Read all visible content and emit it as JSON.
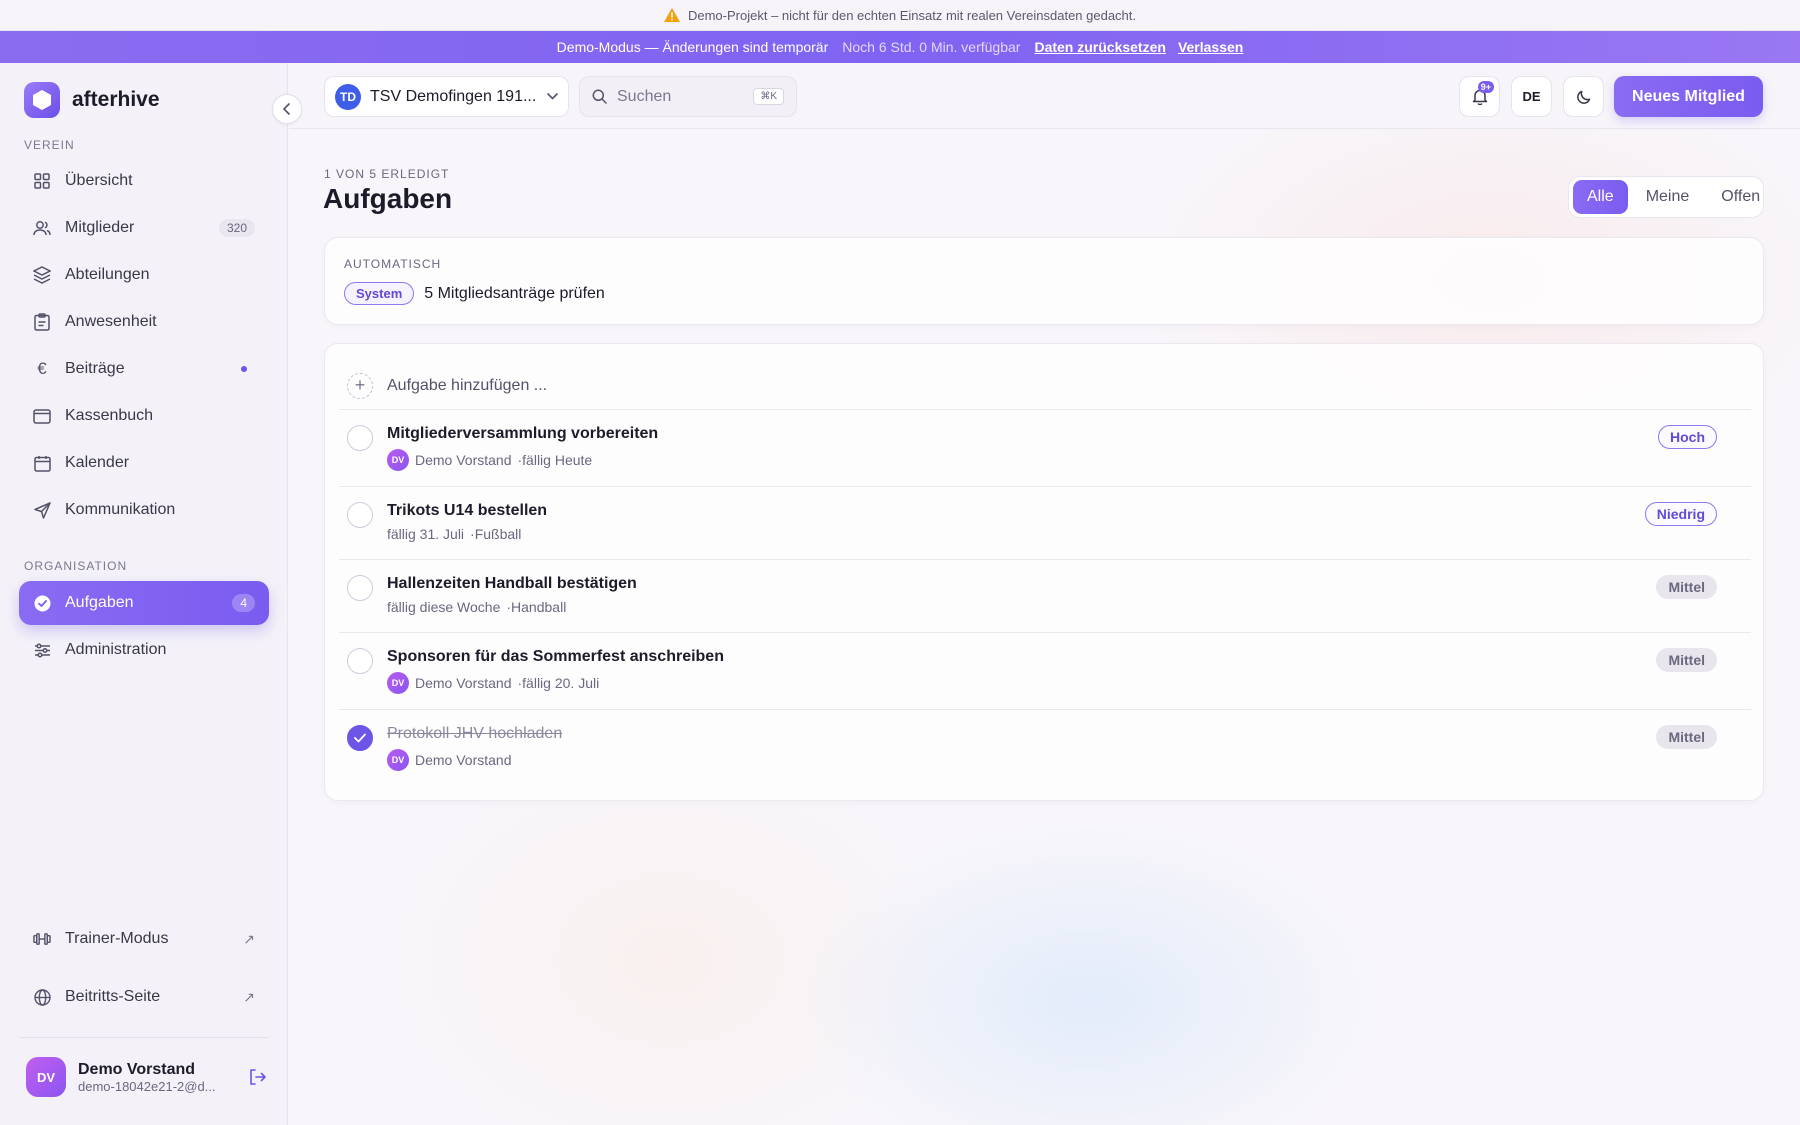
{
  "notice": {
    "text": "Demo-Projekt – nicht für den echten Einsatz mit realen Vereinsdaten gedacht.",
    "icon": "warning-icon"
  },
  "demo_bar": {
    "mode_text": "Demo-Modus — Änderungen sind temporär",
    "time_text": "Noch 6 Std. 0 Min. verfügbar",
    "reset_link": "Daten zurücksetzen",
    "leave_link": "Verlassen"
  },
  "brand": {
    "name": "afterhive"
  },
  "sidebar": {
    "section_verein": "VEREIN",
    "section_organisation": "ORGANISATION",
    "items": [
      {
        "label": "Übersicht",
        "icon": "grid-icon"
      },
      {
        "label": "Mitglieder",
        "icon": "users-icon",
        "count": "320"
      },
      {
        "label": "Abteilungen",
        "icon": "layers-icon"
      },
      {
        "label": "Anwesenheit",
        "icon": "clipboard-icon"
      },
      {
        "label": "Beiträge",
        "icon": "euro-icon"
      },
      {
        "label": "Kassenbuch",
        "icon": "wallet-icon"
      },
      {
        "label": "Kalender",
        "icon": "calendar-icon"
      },
      {
        "label": "Kommunikation",
        "icon": "send-icon"
      },
      {
        "label": "Aufgaben",
        "icon": "check-circle-icon",
        "count": "4",
        "active": true
      },
      {
        "label": "Administration",
        "icon": "sliders-icon"
      }
    ],
    "trainer": "Trainer-Modus",
    "join_page": "Beitritts-Seite",
    "user": {
      "initials": "DV",
      "name": "Demo Vorstand",
      "email": "demo-18042e21-2@d..."
    }
  },
  "header": {
    "org_initials": "TD",
    "org_name": "TSV Demofingen 191...",
    "search_placeholder": "Suchen",
    "search_shortcut": "⌘K",
    "notification_badge": "9+",
    "language": "DE",
    "new_member_button": "Neues Mitglied"
  },
  "page": {
    "kicker": "1 VON 5 ERLEDIGT",
    "title": "Aufgaben",
    "filters": [
      "Alle",
      "Meine",
      "Offen"
    ],
    "active_filter": "Alle"
  },
  "automatic": {
    "label": "AUTOMATISCH",
    "pill": "System",
    "text": "5 Mitgliedsanträge prüfen"
  },
  "tasks": {
    "add_placeholder": "Aufgabe hinzufügen ...",
    "items": [
      {
        "title": "Mitgliederversammlung vorbereiten",
        "assignee_initials": "DV",
        "assignee": "Demo Vorstand",
        "meta": "·fällig Heute",
        "priority": "Hoch",
        "done": false
      },
      {
        "title": "Trikots U14 bestellen",
        "due": "fällig 31. Juli",
        "meta": "·Fußball",
        "priority": "Niedrig",
        "done": false
      },
      {
        "title": "Hallenzeiten Handball bestätigen",
        "due": "fällig diese Woche",
        "meta": "·Handball",
        "priority": "Mittel",
        "done": false
      },
      {
        "title": "Sponsoren für das Sommerfest anschreiben",
        "assignee_initials": "DV",
        "assignee": "Demo Vorstand",
        "meta": "·fällig 20. Juli",
        "priority": "Mittel",
        "done": false
      },
      {
        "title": "Protokoll JHV hochladen",
        "assignee_initials": "DV",
        "assignee": "Demo Vorstand",
        "priority": "Mittel",
        "done": true
      }
    ]
  },
  "colors": {
    "accent": "#7a5cf0",
    "warning": "#f59e0b"
  }
}
